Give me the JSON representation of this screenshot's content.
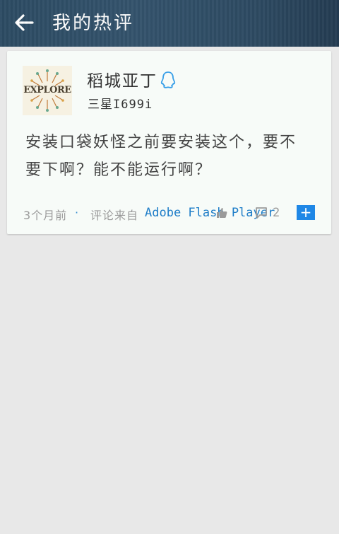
{
  "header": {
    "title": "我的热评",
    "back_icon": "arrow-left-icon",
    "background": "#2c4b63"
  },
  "comment_card": {
    "avatar": {
      "text": "EXPLORE"
    },
    "username": "稻城亚丁",
    "badge_icon": "qq-penguin-icon",
    "device": "三星I699i",
    "comment_text": "安装口袋妖怪之前要安装这个，要不要下啊？能不能运行啊？",
    "time": "3个月前",
    "separator": "·",
    "source_label": "评论来自",
    "source_app": "Adobe Flash Player",
    "like_icon": "thumbs-up-icon",
    "reply_icon": "comment-icon",
    "reply_count": "2",
    "plus_label": "+",
    "accent_color": "#1f87e6"
  }
}
